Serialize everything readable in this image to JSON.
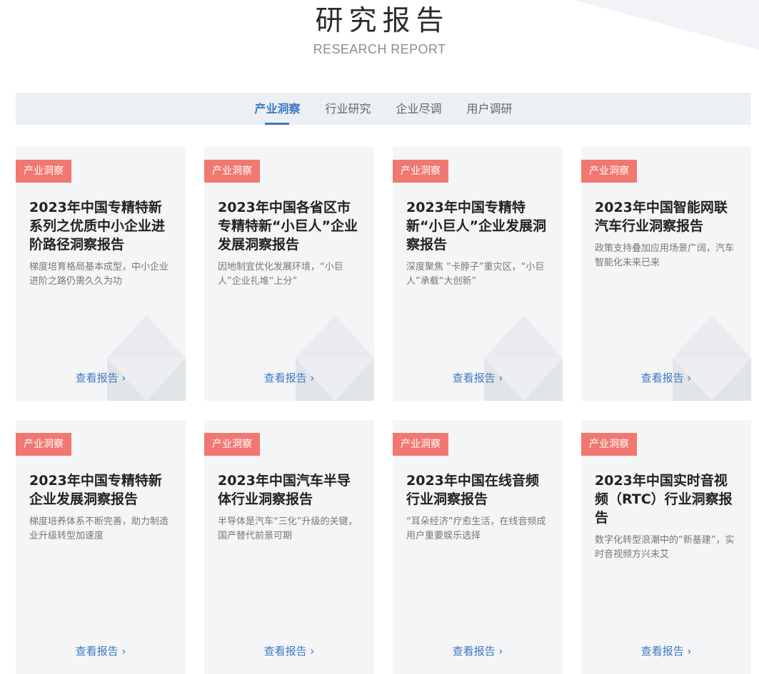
{
  "header": {
    "title_cn": "研究报告",
    "title_en": "RESEARCH REPORT"
  },
  "tabs": [
    {
      "label": "产业洞察",
      "active": true
    },
    {
      "label": "行业研究",
      "active": false
    },
    {
      "label": "企业尽调",
      "active": false
    },
    {
      "label": "用户调研",
      "active": false
    }
  ],
  "colors": {
    "accent": "#3a78c3",
    "tag_bg": "#f07870",
    "card_bg": "#f4f5f7",
    "tabbar_bg": "#eceff3"
  },
  "cards": [
    {
      "tag": "产业洞察",
      "title": "2023年中国专精特新系列之优质中小企业进阶路径洞察报告",
      "desc": "梯度培育格局基本成型，中小企业进阶之路仍需久久为功",
      "link": "查看报告 ›"
    },
    {
      "tag": "产业洞察",
      "title": "2023年中国各省区市专精特新“小巨人”企业发展洞察报告",
      "desc": "因地制宜优化发展环境，“小巨人”企业扎堆“上分”",
      "link": "查看报告 ›"
    },
    {
      "tag": "产业洞察",
      "title": "2023年中国专精特新“小巨人”企业发展洞察报告",
      "desc": "深度聚焦 “卡脖子”重灾区，“小巨人”承载“大创新”",
      "link": "查看报告 ›"
    },
    {
      "tag": "产业洞察",
      "title": "2023年中国智能网联汽车行业洞察报告",
      "desc": "政策支持叠加应用场景广阔，汽车智能化未来已来",
      "link": "查看报告 ›"
    },
    {
      "tag": "产业洞察",
      "title": "2023年中国专精特新企业发展洞察报告",
      "desc": "梯度培养体系不断完善，助力制造业升级转型加速度",
      "link": "查看报告 ›"
    },
    {
      "tag": "产业洞察",
      "title": "2023年中国汽车半导体行业洞察报告",
      "desc": "半导体是汽车“三化”升级的关键，国产替代前景可期",
      "link": "查看报告 ›"
    },
    {
      "tag": "产业洞察",
      "title": "2023年中国在线音频行业洞察报告",
      "desc": "“耳朵经济”疗愈生活，在线音频成用户重要娱乐选择",
      "link": "查看报告 ›"
    },
    {
      "tag": "产业洞察",
      "title": "2023年中国实时音视频（RTC）行业洞察报告",
      "desc": "数字化转型浪潮中的“新基建”，实时音视频方兴未艾",
      "link": "查看报告 ›"
    }
  ]
}
